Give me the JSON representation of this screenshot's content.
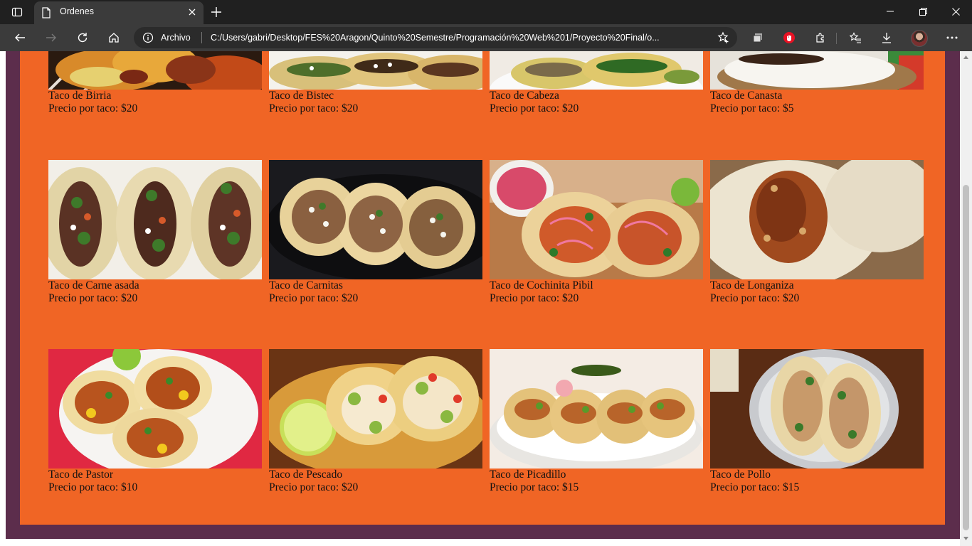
{
  "browser": {
    "tab_title": "Ordenes",
    "omnibox_label": "Archivo",
    "url": "C:/Users/gabri/Desktop/FES%20Aragon/Quinto%20Semestre/Programación%20Web%201/Proyecto%20Final/o..."
  },
  "menu": {
    "rows": [
      [
        {
          "name": "Taco de Birria",
          "price": "Precio por taco: $20"
        },
        {
          "name": "Taco de Bistec",
          "price": "Precio por taco: $20"
        },
        {
          "name": "Taco de Cabeza",
          "price": "Precio por taco: $20"
        },
        {
          "name": "Taco de Canasta",
          "price": "Precio por taco: $5"
        }
      ],
      [
        {
          "name": "Taco de Carne asada",
          "price": "Precio por taco: $20"
        },
        {
          "name": "Taco de Carnitas",
          "price": "Precio por taco: $20"
        },
        {
          "name": "Taco de Cochinita Pibil",
          "price": "Precio por taco: $20"
        },
        {
          "name": "Taco de Longaniza",
          "price": "Precio por taco: $20"
        }
      ],
      [
        {
          "name": "Taco de Pastor",
          "price": "Precio por taco: $10"
        },
        {
          "name": "Taco de Pescado",
          "price": "Precio por taco: $20"
        },
        {
          "name": "Taco de Picadillo",
          "price": "Precio por taco: $15"
        },
        {
          "name": "Taco de Pollo",
          "price": "Precio por taco: $15"
        }
      ]
    ]
  },
  "colors": {
    "panel": "#f06525",
    "frame": "#5c2d4c"
  }
}
